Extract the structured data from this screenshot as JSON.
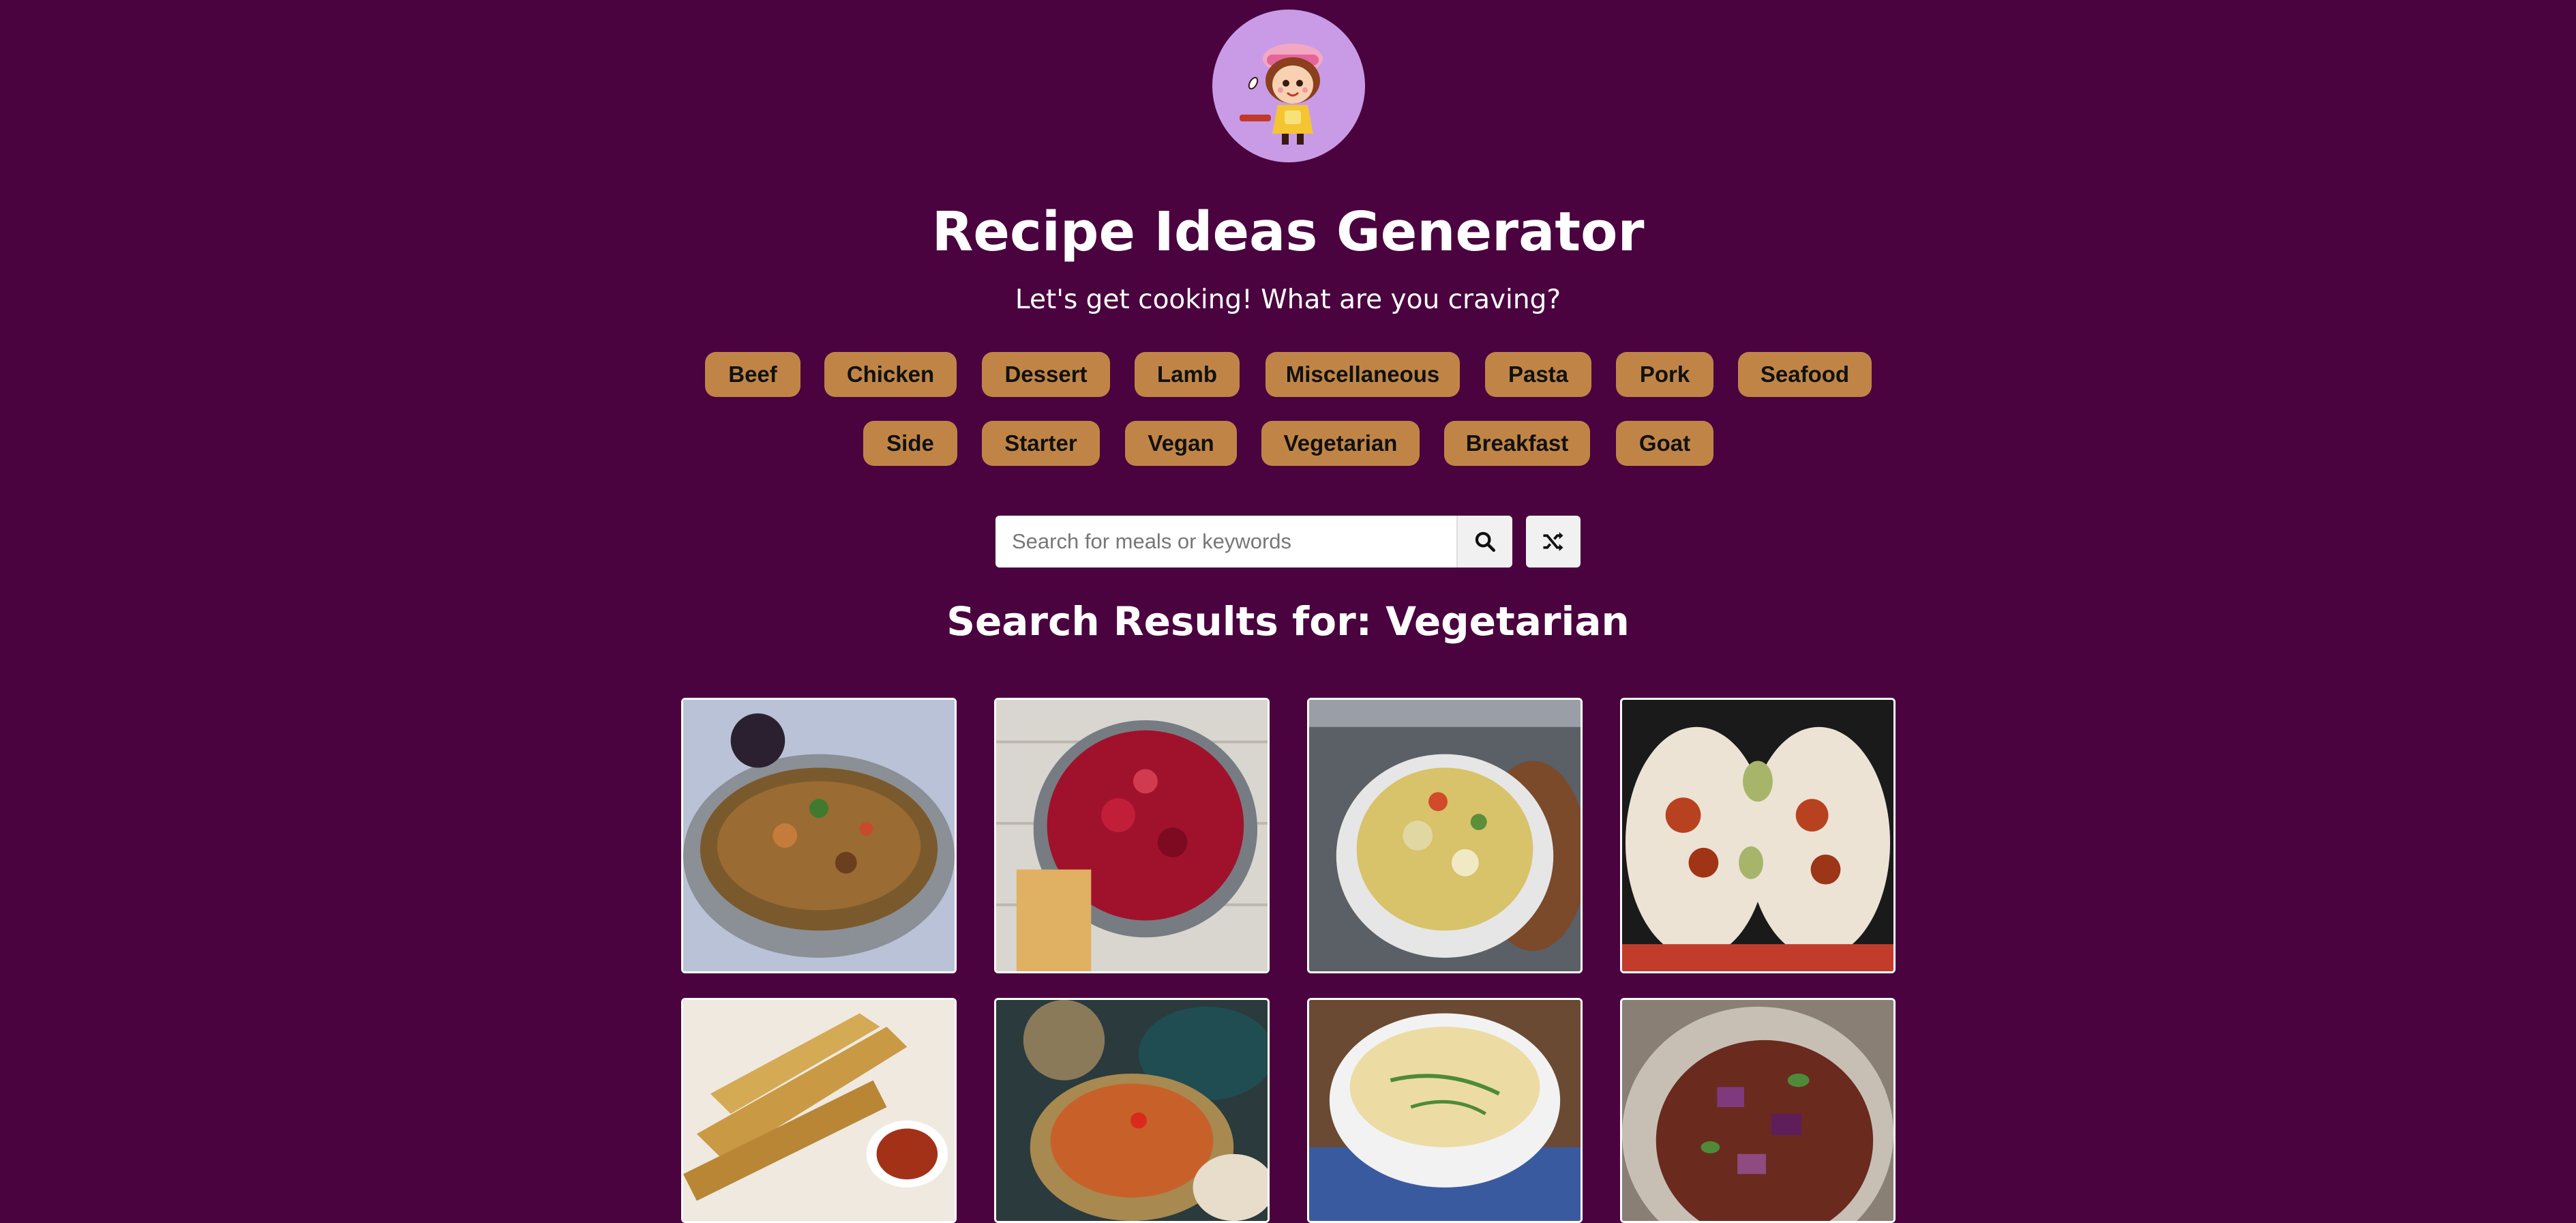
{
  "header": {
    "title": "Recipe Ideas Generator",
    "subtitle": "Let's get cooking! What are you craving?"
  },
  "categories": {
    "row1": [
      "Beef",
      "Chicken",
      "Dessert",
      "Lamb",
      "Miscellaneous",
      "Pasta",
      "Pork",
      "Seafood"
    ],
    "row2": [
      "Side",
      "Starter",
      "Vegan",
      "Vegetarian",
      "Breakfast",
      "Goat"
    ]
  },
  "search": {
    "placeholder": "Search for meals or keywords",
    "value": "",
    "search_icon": "search-icon",
    "random_icon": "shuffle-icon"
  },
  "results": {
    "heading": "Search Results for: Vegetarian",
    "items": [
      {
        "image": "meal-image"
      },
      {
        "image": "meal-image"
      },
      {
        "image": "meal-image"
      },
      {
        "image": "meal-image"
      },
      {
        "image": "meal-image"
      },
      {
        "image": "meal-image"
      },
      {
        "image": "meal-image"
      },
      {
        "image": "meal-image"
      }
    ]
  },
  "colors": {
    "background": "#4a033f",
    "button": "#c08546",
    "logo_bg": "#c99be6",
    "text": "#ffffff"
  }
}
